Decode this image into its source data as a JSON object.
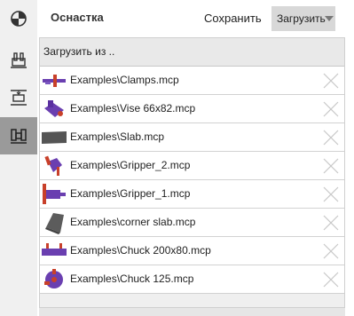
{
  "sidebar": {
    "items": [
      {
        "icon": "balance-icon",
        "active": false
      },
      {
        "icon": "fixture-icon",
        "active": false
      },
      {
        "icon": "align-icon",
        "active": false
      },
      {
        "icon": "clamp-library-icon",
        "active": true
      }
    ]
  },
  "header": {
    "title": "Оснастка",
    "save_label": "Сохранить",
    "load_label": "Загрузить"
  },
  "list": {
    "load_from_label": "Загрузить из ..",
    "items": [
      {
        "label": "Examples\\Clamps.mcp",
        "icon": "clamps-thumbnail-icon"
      },
      {
        "label": "Examples\\Vise 66x82.mcp",
        "icon": "vise-thumbnail-icon"
      },
      {
        "label": "Examples\\Slab.mcp",
        "icon": "slab-thumbnail-icon"
      },
      {
        "label": "Examples\\Gripper_2.mcp",
        "icon": "gripper-thumbnail-icon"
      },
      {
        "label": "Examples\\Gripper_1.mcp",
        "icon": "gripper-thumbnail-icon"
      },
      {
        "label": "Examples\\corner slab.mcp",
        "icon": "corner-slab-thumbnail-icon"
      },
      {
        "label": "Examples\\Chuck 200x80.mcp",
        "icon": "chuck-thumbnail-icon"
      },
      {
        "label": "Examples\\Chuck 125.mcp",
        "icon": "chuck-thumbnail-icon"
      }
    ]
  },
  "colors": {
    "accent_purple": "#6a3fb0",
    "accent_red": "#c8402a",
    "active_sidebar": "#9a9a9a"
  }
}
